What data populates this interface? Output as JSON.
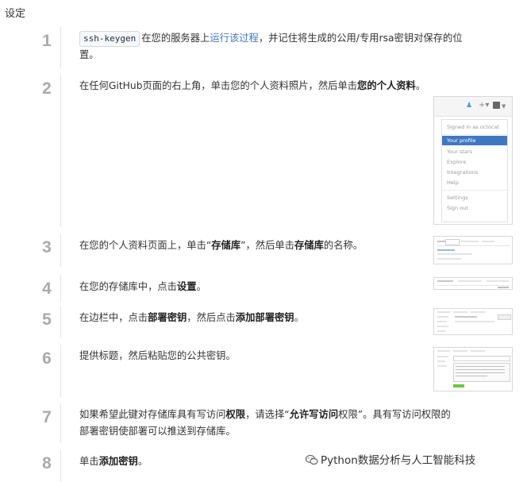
{
  "heading": "设定",
  "steps": [
    {
      "number": "1",
      "code": "ssh-keygen",
      "text_a": "在您的服务器上",
      "link": "运行该过程",
      "text_b": "，并记住将生成的公用/专用rsa密钥对保存的位",
      "text_c": "置。"
    },
    {
      "number": "2",
      "text_a": "在任何GitHub页面的右上角，单击您的个人资料照片，然后单击",
      "bold": "您的个人资料",
      "text_b": "。"
    },
    {
      "number": "3",
      "text_a": "在您的个人资料页面上，单击“",
      "bold_a": "存储库",
      "text_b": "”，然后单击",
      "bold_b": "存储库",
      "text_c": "的名称。"
    },
    {
      "number": "4",
      "text_a": "在您的存储库中，点击",
      "bold": "设置",
      "text_b": "。"
    },
    {
      "number": "5",
      "text_a": "在边栏中，点击",
      "bold_a": "部署密钥",
      "text_b": "，然后点击",
      "bold_b": "添加部署密钥",
      "text_c": "。"
    },
    {
      "number": "6",
      "text_a": "提供标题，然后粘贴您的公共密钥。"
    },
    {
      "number": "7",
      "text_a": "如果希望此键对存储库具有写访问",
      "bold_a": "权限",
      "text_b": "，请选择“",
      "bold_b": "允许写访问",
      "text_c": "权限”。具有写访问权限的",
      "text_d": "部署密钥使部署可以推送到存储库。"
    },
    {
      "number": "8",
      "text_a": "单击",
      "bold": "添加密钥",
      "text_b": "。"
    }
  ],
  "dropdown": {
    "signed_in": "Signed in as octocat",
    "items": [
      "Your profile",
      "Your stars",
      "Explore",
      "Integrations",
      "Help",
      "Settings",
      "Sign out"
    ],
    "highlight_color": "#4078c0"
  },
  "watermark": "Python数据分析与人工智能科技",
  "colors": {
    "link": "#4078c0",
    "step_number": "#aaaaaa"
  }
}
